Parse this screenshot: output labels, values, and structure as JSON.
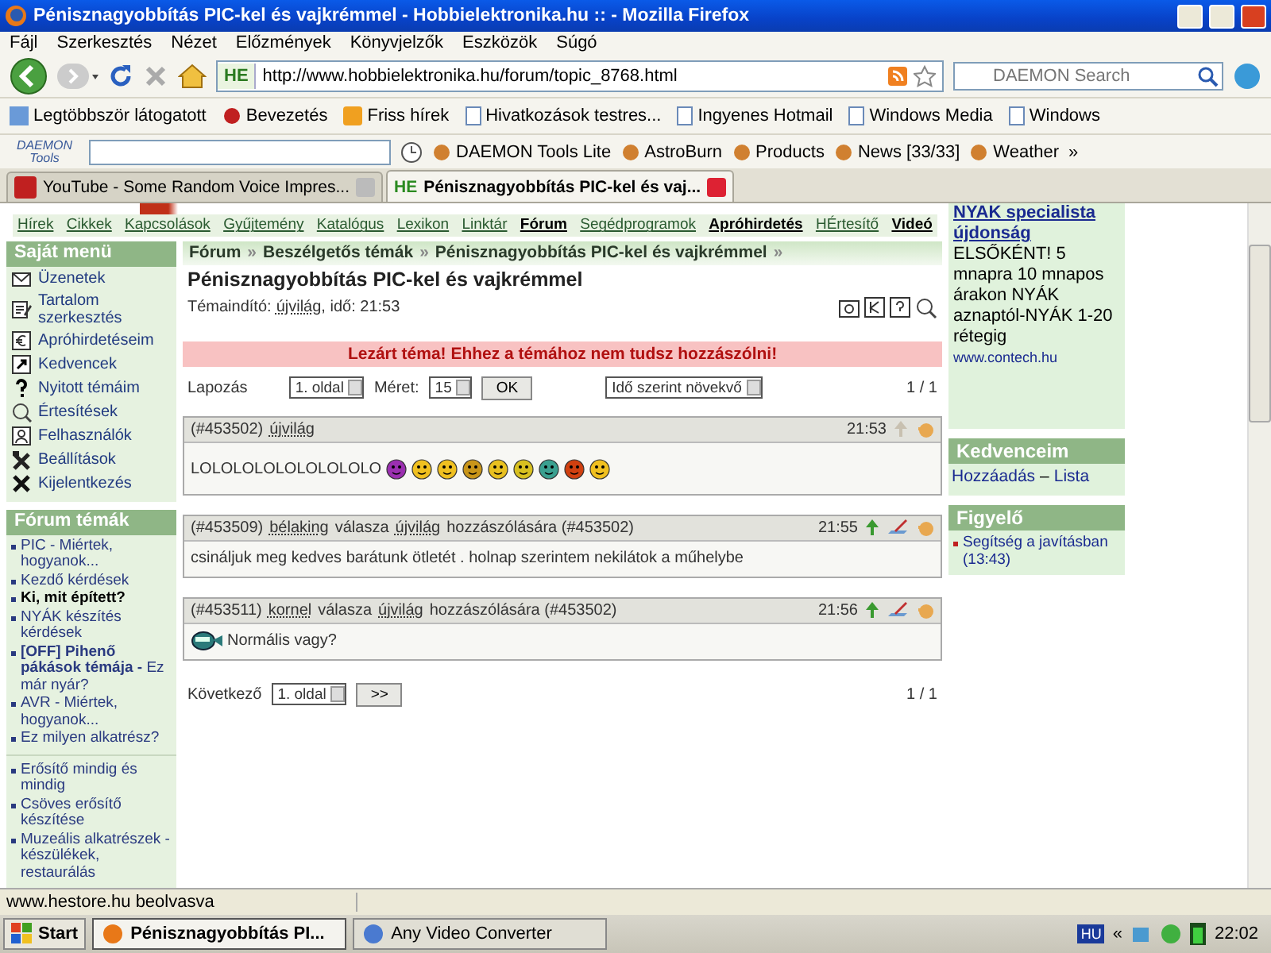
{
  "window": {
    "title": "Pénisznagyobbítás PIC-kel és vajkrémmel - Hobbielektronika.hu :: - Mozilla Firefox"
  },
  "menu": [
    "Fájl",
    "Szerkesztés",
    "Nézet",
    "Előzmények",
    "Könyvjelzők",
    "Eszközök",
    "Súgó"
  ],
  "address": {
    "badge": "HE",
    "url": "http://www.hobbielektronika.hu/forum/topic_8768.html"
  },
  "search": {
    "placeholder": "DAEMON Search"
  },
  "bookmarks": [
    "Legtöbbször látogatott",
    "Bevezetés",
    "Friss hírek",
    "Hivatkozások testres...",
    "Ingyenes Hotmail",
    "Windows Media",
    "Windows"
  ],
  "daemon_toolbar": {
    "logo_top": "DAEMON",
    "logo_bottom": "Tools",
    "items": [
      "DAEMON Tools Lite",
      "AstroBurn",
      "Products",
      "News [33/33]",
      "Weather"
    ],
    "more": "»"
  },
  "tabs": [
    {
      "label": "YouTube - Some Random Voice Impres...",
      "selected": false
    },
    {
      "label": "Pénisznagyobbítás PIC-kel és vaj...",
      "selected": true,
      "badge": "HE"
    }
  ],
  "site_nav": [
    {
      "label": "Hírek",
      "bold": false
    },
    {
      "label": "Cikkek",
      "bold": false
    },
    {
      "label": "Kapcsolások",
      "bold": false
    },
    {
      "label": "Gyűjtemény",
      "bold": false
    },
    {
      "label": "Katalógus",
      "bold": false
    },
    {
      "label": "Lexikon",
      "bold": false
    },
    {
      "label": "Linktár",
      "bold": false
    },
    {
      "label": "Fórum",
      "bold": true
    },
    {
      "label": "Segédprogramok",
      "bold": false
    },
    {
      "label": "Apróhirdetés",
      "bold": true
    },
    {
      "label": "HÉrtesítő",
      "bold": false
    },
    {
      "label": "Videó",
      "bold": true
    }
  ],
  "own_menu": {
    "title": "Saját menü",
    "items": [
      "Üzenetek",
      "Tartalom szerkesztés",
      "Apróhirdetéseim",
      "Kedvencek",
      "Nyitott témáim",
      "Értesítések",
      "Felhasználók",
      "Beállítások",
      "Kijelentkezés"
    ]
  },
  "forum_topics": {
    "title": "Fórum témák",
    "groups": [
      [
        {
          "text": "PIC - Miértek, hogyanok...",
          "bold": false
        },
        {
          "text": "Kezdő kérdések",
          "bold": false
        },
        {
          "text": "Ki, mit épített?",
          "bold": true
        },
        {
          "text": "NYÁK készítés kérdések",
          "bold": false
        },
        {
          "text": "**[OFF] Pihenő pákások témája -** Ez már nyár?",
          "bold": false
        },
        {
          "text": "AVR - Miértek, hogyanok...",
          "bold": false
        },
        {
          "text": "Ez milyen alkatrész?",
          "bold": false
        }
      ],
      [
        {
          "text": "Erősítő mindig és mindig",
          "bold": false
        },
        {
          "text": "Csöves erősítő készítése",
          "bold": false
        },
        {
          "text": "Muzeális alkatrészek - készülékek, restaurálás",
          "bold": false
        }
      ]
    ]
  },
  "breadcrumb": {
    "items": [
      "Fórum",
      "Beszélgetős témák",
      "Pénisznagyobbítás PIC-kel és vajkrémmel"
    ],
    "separator": "»"
  },
  "topic": {
    "title": "Pénisznagyobbítás PIC-kel és vajkrémmel",
    "starter_label": "Témaindító:",
    "starter": "újvilág",
    "time": ", idő: 21:53"
  },
  "locked_notice": "Lezárt téma! Ehhez a témához nem tudsz hozzászólni!",
  "pager_top": {
    "label": "Lapozás",
    "page": "1. oldal",
    "size_label": "Méret:",
    "size": "15",
    "button": "OK",
    "sort": "Idő szerint növekvő",
    "count": "1 / 1"
  },
  "posts": [
    {
      "kind": "original",
      "id": "(#453502)",
      "author": "újvilág",
      "time": "21:53",
      "body": "LOLOLOLOLOLOLOLOLO",
      "emoticons_after": true,
      "emoticon_before": false
    },
    {
      "kind": "reply",
      "id": "(#453509)",
      "author": "bélaking",
      "reply_word": "válasza",
      "reply_to": "újvilág",
      "reply_suffix": "hozzászólására (#453502)",
      "time": "21:55",
      "body": "csináljuk meg kedves barátunk ötletét . holnap szerintem nekilátok a műhelybe",
      "emoticons_after": false,
      "emoticon_before": false
    },
    {
      "kind": "reply",
      "id": "(#453511)",
      "author": "kornel",
      "reply_word": "válasza",
      "reply_to": "újvilág",
      "reply_suffix": "hozzászólására (#453502)",
      "time": "21:56",
      "body": "Normális vagy?",
      "emoticons_after": false,
      "emoticon_before": true
    }
  ],
  "pager_bottom": {
    "label": "Következő",
    "page": "1. oldal",
    "button": ">>",
    "count": "1 / 1"
  },
  "ad": {
    "headline": "NYAK specialista újdonság",
    "text": "ELSŐKÉNT! 5 mnapra 10 mnapos árakon NYÁK aznaptól-NYÁK 1-20 rétegig",
    "url": "www.contech.hu"
  },
  "favorites": {
    "title": "Kedvenceim",
    "add": "Hozzáadás",
    "dash": "–",
    "list": "Lista"
  },
  "watch": {
    "title": "Figyelő",
    "items": [
      "Segítség a javításban (13:43)"
    ]
  },
  "status_bar": "www.hestore.hu beolvasva",
  "taskbar": {
    "start": "Start",
    "windows": [
      {
        "label": "Pénisznagyobbítás PI...",
        "selected": true
      },
      {
        "label": "Any Video Converter",
        "selected": false
      }
    ],
    "language": "HU",
    "expand": "«",
    "clock": "22:02"
  }
}
